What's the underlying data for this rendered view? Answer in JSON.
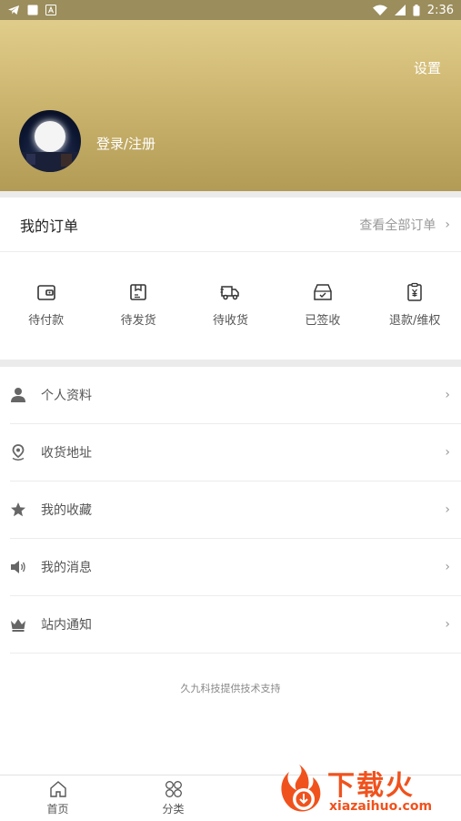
{
  "status_bar": {
    "time": "2:36"
  },
  "header": {
    "settings_label": "设置",
    "login_label": "登录/注册"
  },
  "orders": {
    "title": "我的订单",
    "view_all": "查看全部订单",
    "items": [
      {
        "label": "待付款",
        "icon": "wallet-icon"
      },
      {
        "label": "待发货",
        "icon": "package-icon"
      },
      {
        "label": "待收货",
        "icon": "truck-icon"
      },
      {
        "label": "已签收",
        "icon": "inbox-check-icon"
      },
      {
        "label": "退款/维权",
        "icon": "refund-clipboard-icon"
      }
    ]
  },
  "menu": {
    "items": [
      {
        "label": "个人资料",
        "icon": "person-icon"
      },
      {
        "label": "收货地址",
        "icon": "location-pin-icon"
      },
      {
        "label": "我的收藏",
        "icon": "star-icon"
      },
      {
        "label": "我的消息",
        "icon": "speaker-icon"
      },
      {
        "label": "站内通知",
        "icon": "crown-icon"
      }
    ],
    "footer_note": "久九科技提供技术支持"
  },
  "tabbar": {
    "tabs": [
      {
        "label": "首页",
        "icon": "home-icon"
      },
      {
        "label": "分类",
        "icon": "category-icon"
      }
    ]
  },
  "watermark": {
    "title": "下载火",
    "url": "xiazaihuo.com"
  },
  "colors": {
    "gold_light": "#e1cd8b",
    "gold_dark": "#b29b55",
    "brand_orange": "#f0521d"
  }
}
